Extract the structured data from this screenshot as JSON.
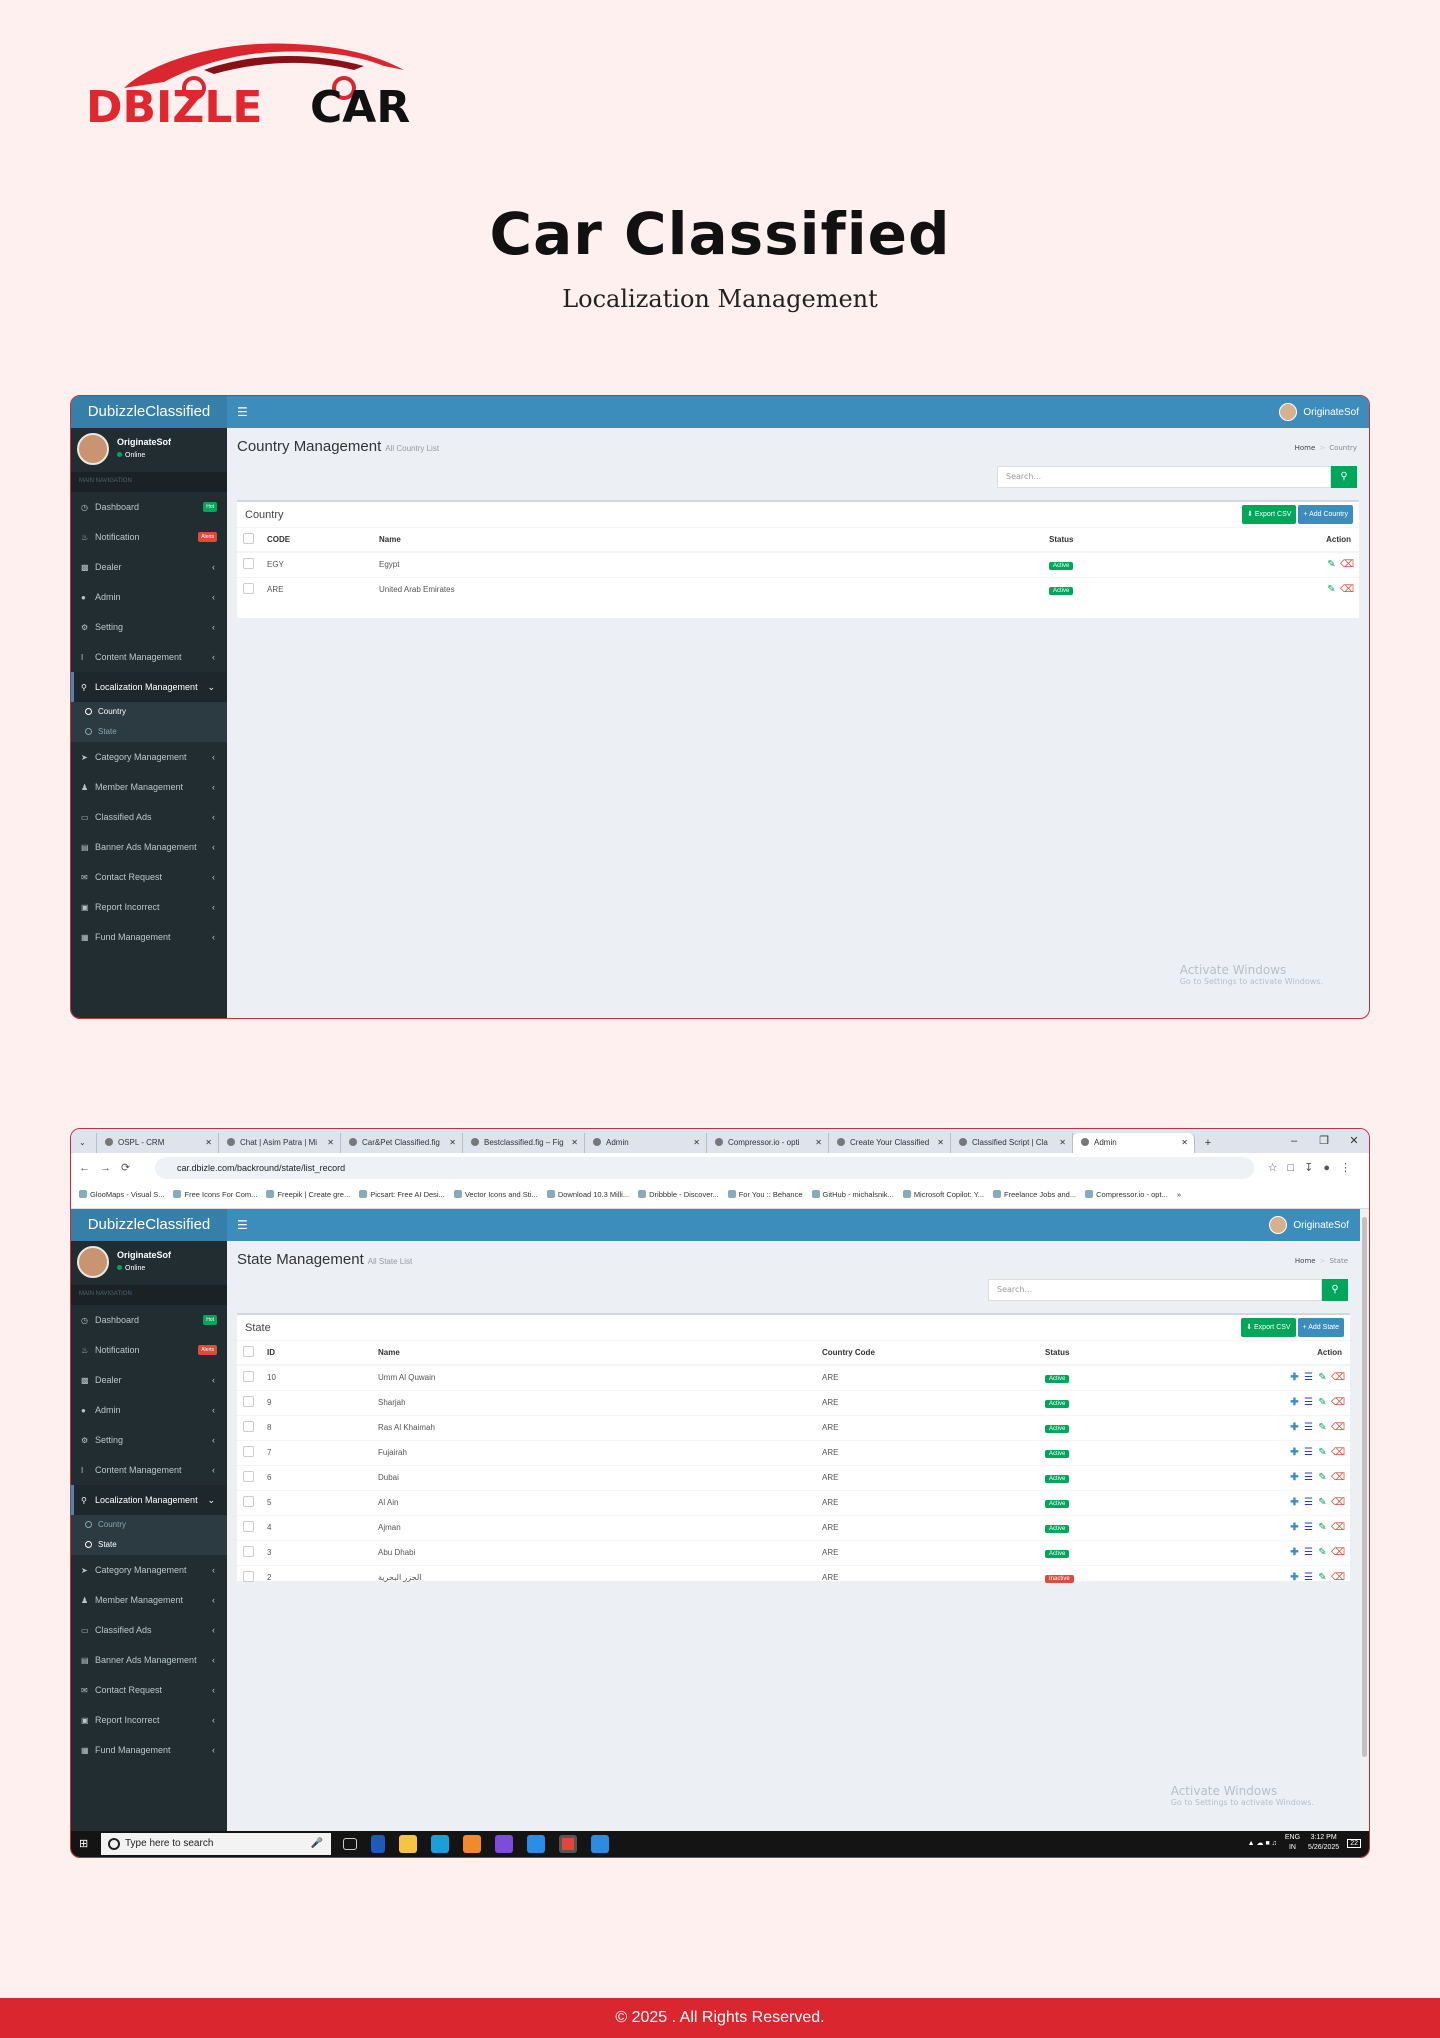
{
  "logo": {
    "part1": "DBIZLE",
    "part2": "CAR"
  },
  "hero": {
    "title": "Car Classified",
    "subtitle": "Localization Management"
  },
  "app": {
    "brand": "DubizzleClassified",
    "menu_icon": "hamburger-icon",
    "user_name": "OriginateSof",
    "user_status": "Online",
    "nav_header": "MAIN NAVIGATION"
  },
  "nav": [
    {
      "label": "Dashboard",
      "icon": "dashboard-icon",
      "badge": "Hot"
    },
    {
      "label": "Notification",
      "icon": "bell-icon",
      "badge": "Alerts"
    },
    {
      "label": "Dealer",
      "icon": "chart-icon"
    },
    {
      "label": "Admin",
      "icon": "user-icon"
    },
    {
      "label": "Setting",
      "icon": "gear-icon"
    },
    {
      "label": "Content Management",
      "icon": "text-cursor-icon"
    },
    {
      "label": "Localization Management",
      "icon": "map-pin-icon"
    },
    {
      "label": "Category Management",
      "icon": "pointer-icon"
    },
    {
      "label": "Member Management",
      "icon": "users-icon"
    },
    {
      "label": "Classified Ads",
      "icon": "archive-icon"
    },
    {
      "label": "Banner Ads Management",
      "icon": "banner-icon"
    },
    {
      "label": "Contact Request",
      "icon": "envelope-icon"
    },
    {
      "label": "Report Incorrect",
      "icon": "file-icon"
    },
    {
      "label": "Fund Management",
      "icon": "money-icon"
    }
  ],
  "subnav": [
    {
      "label": "Country"
    },
    {
      "label": "State"
    }
  ],
  "country_page": {
    "title": "Country Management",
    "subtitle": "All Country List",
    "crumb_home": "Home",
    "crumb_current": "Country",
    "search_placeholder": "Search...",
    "box_title": "Country",
    "export_label": "Export CSV",
    "add_label": "Add Country",
    "columns": {
      "code": "CODE",
      "name": "Name",
      "status": "Status",
      "action": "Action"
    },
    "rows": [
      {
        "code": "EGY",
        "name": "Egypt",
        "status": "Active"
      },
      {
        "code": "ARE",
        "name": "United Arab Emirates",
        "status": "Active"
      }
    ]
  },
  "state_page": {
    "title": "State Management",
    "subtitle": "All State List",
    "crumb_home": "Home",
    "crumb_current": "State",
    "search_placeholder": "Search...",
    "box_title": "State",
    "export_label": "Export CSV",
    "add_label": "Add State",
    "columns": {
      "id": "ID",
      "name": "Name",
      "country_code": "Country Code",
      "status": "Status",
      "action": "Action"
    },
    "rows": [
      {
        "id": "10",
        "name": "Umm Al Quwain",
        "cc": "ARE",
        "status": "Active"
      },
      {
        "id": "9",
        "name": "Sharjah",
        "cc": "ARE",
        "status": "Active"
      },
      {
        "id": "8",
        "name": "Ras Al Khaimah",
        "cc": "ARE",
        "status": "Active"
      },
      {
        "id": "7",
        "name": "Fujairah",
        "cc": "ARE",
        "status": "Active"
      },
      {
        "id": "6",
        "name": "Dubai",
        "cc": "ARE",
        "status": "Active"
      },
      {
        "id": "5",
        "name": "Al Ain",
        "cc": "ARE",
        "status": "Active"
      },
      {
        "id": "4",
        "name": "Ajman",
        "cc": "ARE",
        "status": "Active"
      },
      {
        "id": "3",
        "name": "Abu Dhabi",
        "cc": "ARE",
        "status": "Active"
      },
      {
        "id": "2",
        "name": "الجزر البحرية",
        "cc": "ARE",
        "status": "Inactive"
      }
    ]
  },
  "watermark": {
    "title": "Activate Windows",
    "sub": "Go to Settings to activate Windows."
  },
  "browser": {
    "tabs": [
      "OSPL - CRM",
      "Chat | Asim Patra | Mi",
      "Car&Pet Classified.fig",
      "Bestclassified.fig – Fig",
      "Admin",
      "Compressor.io - opti",
      "Create Your Classified",
      "Classified Script | Cla",
      "Admin"
    ],
    "url": "car.dbizle.com/backround/state/list_record",
    "bookmarks": [
      "GlooMaps - Visual S...",
      "Free Icons For Com...",
      "Freepik | Create gre...",
      "Picsart: Free AI Desi...",
      "Vector Icons and Sti...",
      "Download 10.3 Milli...",
      "Dribbble - Discover...",
      "For You :: Behance",
      "GitHub - michalsnik...",
      "Microsoft Copilot: Y...",
      "Freelance Jobs and...",
      "Compressor.io - opt..."
    ]
  },
  "taskbar": {
    "search": "Type here to search",
    "lang1": "ENG",
    "lang2": "IN",
    "time": "3:12 PM",
    "date": "5/26/2025",
    "notif": "22"
  },
  "footer": "© 2025 . All Rights Reserved.",
  "colors": {
    "brand_red": "#d9262f",
    "topbar_blue": "#3c8dbc",
    "sidebar": "#222d32",
    "active_green": "#00a65a"
  }
}
